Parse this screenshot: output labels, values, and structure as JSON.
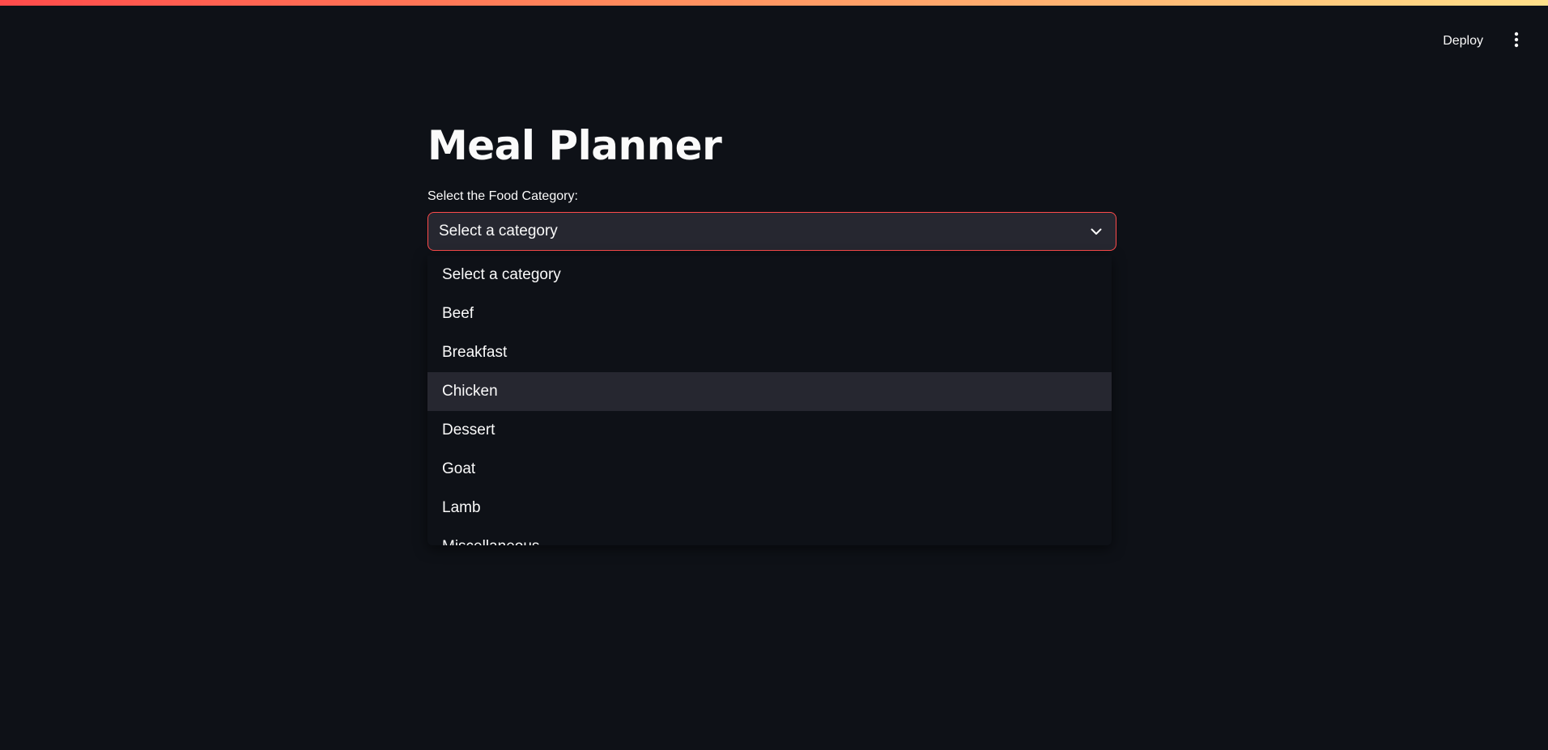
{
  "header": {
    "deploy_label": "Deploy",
    "menu_icon": "kebab-vertical-icon"
  },
  "colors": {
    "background": "#0e1117",
    "widget_background": "#262730",
    "accent": "#ff4b4b",
    "text": "#fafafa"
  },
  "main": {
    "title": "Meal Planner",
    "category_select": {
      "label": "Select the Food Category:",
      "value": "Select a category",
      "icon": "chevron-down-icon",
      "options": [
        "Select a category",
        "Beef",
        "Breakfast",
        "Chicken",
        "Dessert",
        "Goat",
        "Lamb",
        "Miscellaneous"
      ],
      "highlighted_option": "Chicken"
    }
  }
}
